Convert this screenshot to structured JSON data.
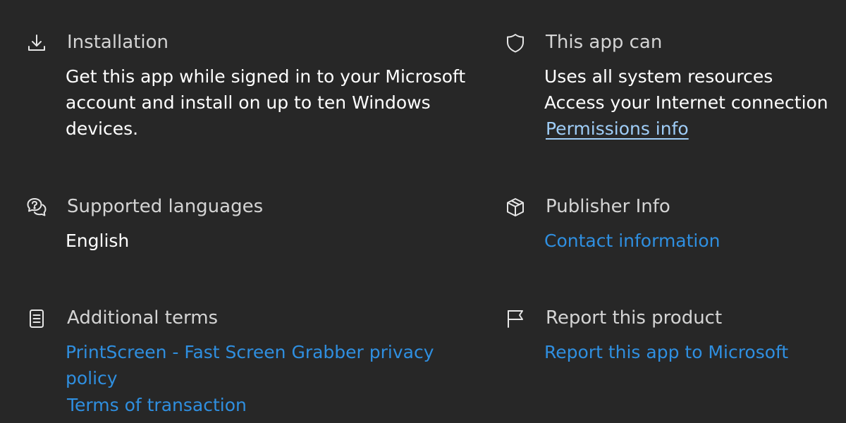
{
  "colors": {
    "background": "#272727",
    "heading": "#d4d4d4",
    "text": "#ffffff",
    "link": "#2f8fe0",
    "link_visited": "#9fcdf7"
  },
  "installation": {
    "icon": "download-icon",
    "heading": "Installation",
    "lines": [
      "Get this app while signed in to your Microsoft",
      "account and install on up to ten Windows",
      "devices."
    ]
  },
  "permissions": {
    "icon": "shield-icon",
    "heading": "This app can",
    "lines": [
      "Uses all system resources",
      "Access your Internet connection"
    ],
    "link": "Permissions info"
  },
  "languages": {
    "icon": "chat-bubbles-icon",
    "heading": "Supported languages",
    "value": "English"
  },
  "publisher": {
    "icon": "package-icon",
    "heading": "Publisher Info",
    "link": "Contact information"
  },
  "terms": {
    "icon": "document-icon",
    "heading": "Additional terms",
    "privacy_link_lines": [
      "PrintScreen - Fast Screen Grabber privacy",
      "policy"
    ],
    "transaction_link": "Terms of transaction"
  },
  "report": {
    "icon": "flag-icon",
    "heading": "Report this product",
    "link": "Report this app to Microsoft"
  }
}
